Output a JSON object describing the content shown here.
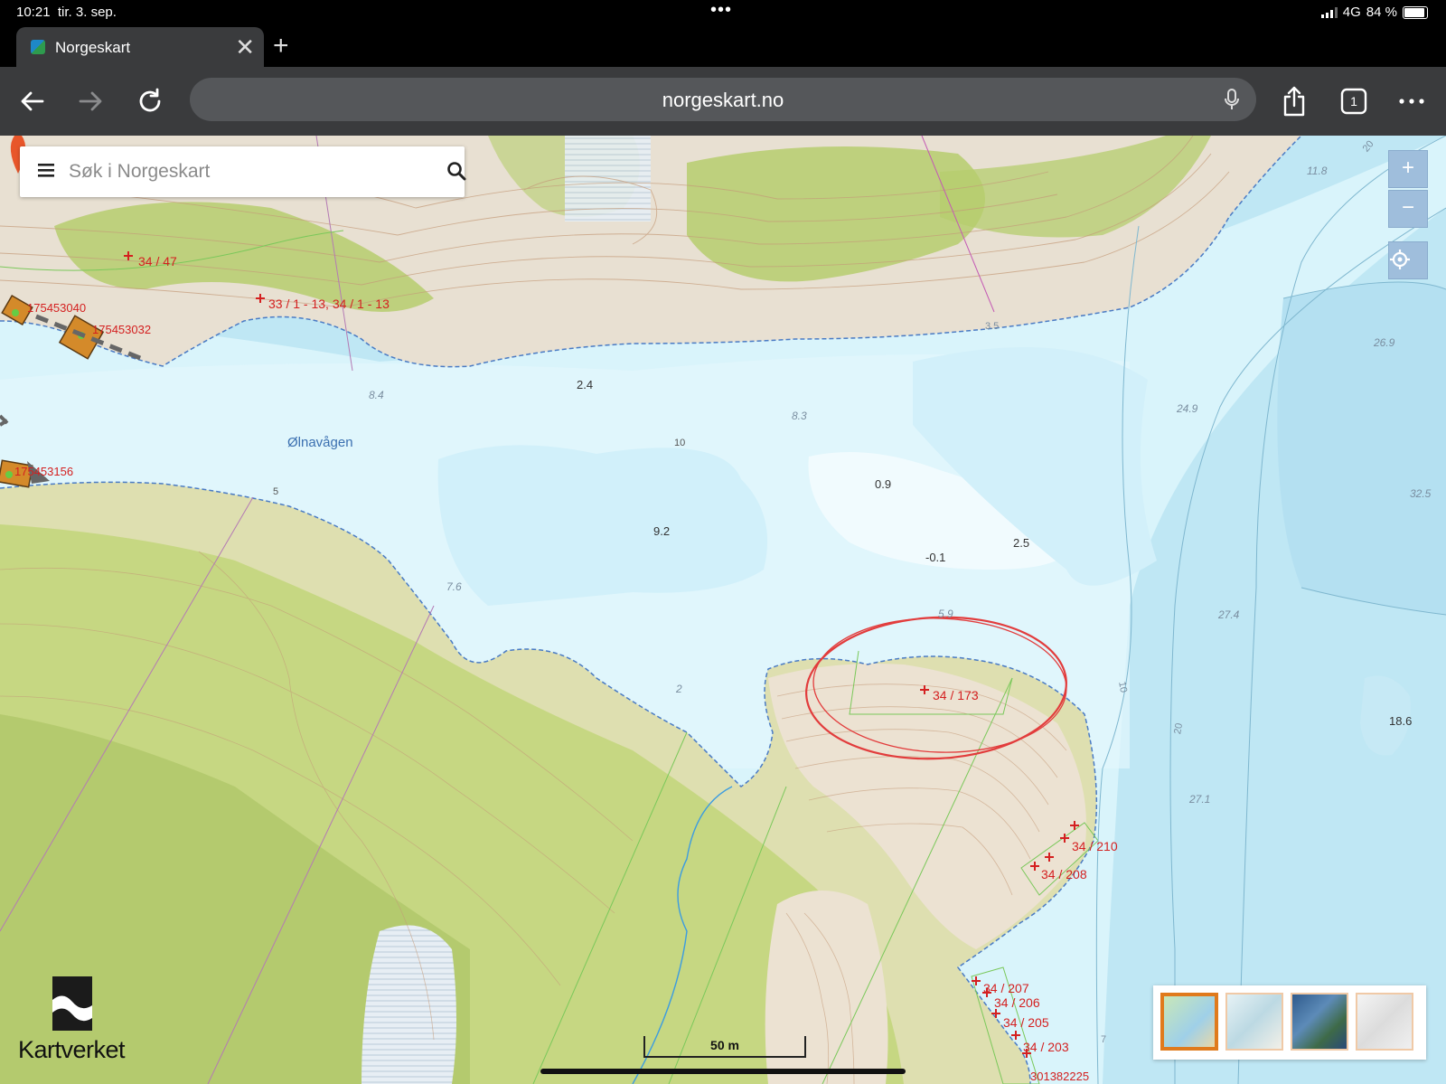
{
  "status_bar": {
    "time": "10:21",
    "date": "tir. 3. sep.",
    "dots": "•••",
    "network": "4G",
    "battery": "84 %",
    "battery_level": 0.84
  },
  "tab": {
    "title": "Norgeskart",
    "close": "✕",
    "new_tab": "+"
  },
  "toolbar": {
    "url": "norgeskart.no",
    "tab_count": "1"
  },
  "search": {
    "placeholder": "Søk i Norgeskart"
  },
  "zoom": {
    "in": "+",
    "out": "−"
  },
  "map": {
    "place_name": "Ølnavågen",
    "parcels": [
      "34 / 47",
      "33 / 1 - 13, 34 / 1 - 13",
      "34 / 173",
      "34 / 210",
      "34 / 208",
      "34 / 207",
      "34 / 206",
      "34 / 205",
      "34 / 203"
    ],
    "buildings": [
      "175453040",
      "175453032",
      "175453156",
      "301382225"
    ],
    "depths": [
      "2.4",
      "8.4",
      "8.3",
      "9.2",
      "0.9",
      "-0.1",
      "2.5",
      "5.9",
      "7.6",
      "2",
      "11.8",
      "26.9",
      "24.9",
      "32.5",
      "27.4",
      "18.6",
      "27.1"
    ],
    "depth_contours": [
      "10",
      "5",
      "3.5",
      "20",
      "10",
      "20",
      "7"
    ],
    "scale": "50 m"
  },
  "logo": {
    "text": "Kartverket"
  }
}
